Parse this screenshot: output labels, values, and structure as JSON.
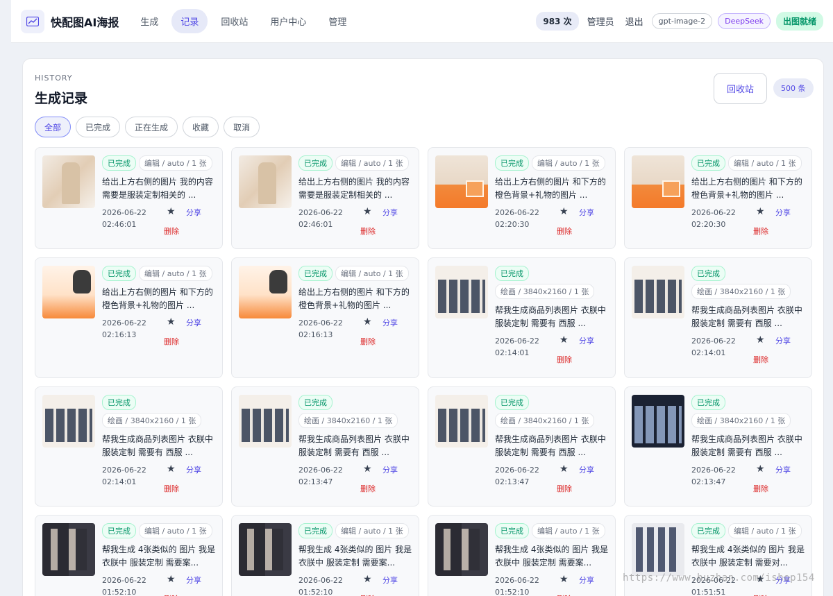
{
  "header": {
    "brand": "快配图AI海报",
    "nav": [
      "生成",
      "记录",
      "回收站",
      "用户中心",
      "管理"
    ],
    "active_nav": "记录",
    "count": "983 次",
    "role": "管理员",
    "logout": "退出",
    "model": "gpt-image-2",
    "llm": "DeepSeek",
    "status": "出图就绪"
  },
  "main": {
    "eyebrow": "HISTORY",
    "title": "生成记录",
    "recycle_label": "回收站",
    "total": "500 条",
    "filters": [
      "全部",
      "已完成",
      "正在生成",
      "收藏",
      "取消"
    ],
    "active_filter": "全部"
  },
  "card_labels": {
    "done": "已完成",
    "share": "分享",
    "delete": "删除",
    "star": "★"
  },
  "records": [
    {
      "thumb": "suit-white",
      "meta": "编辑 / auto / 1 张",
      "prompt": "给出上方右侧的图片 我的内容需要是服装定制相关的 ...",
      "date": "2026-06-22",
      "time": "02:46:01"
    },
    {
      "thumb": "suit-white",
      "meta": "编辑 / auto / 1 张",
      "prompt": "给出上方右侧的图片 我的内容需要是服装定制相关的 ...",
      "date": "2026-06-22",
      "time": "02:46:01"
    },
    {
      "thumb": "suit-orange",
      "meta": "编辑 / auto / 1 张",
      "prompt": "给出上方右侧的图片 和下方的 橙色背景+礼物的图片 ...",
      "date": "2026-06-22",
      "time": "02:20:30"
    },
    {
      "thumb": "suit-orange",
      "meta": "编辑 / auto / 1 张",
      "prompt": "给出上方右侧的图片 和下方的 橙色背景+礼物的图片 ...",
      "date": "2026-06-22",
      "time": "02:20:30"
    },
    {
      "thumb": "cat",
      "meta": "编辑 / auto / 1 张",
      "prompt": "给出上方右侧的图片 和下方的 橙色背景+礼物的图片 ...",
      "date": "2026-06-22",
      "time": "02:16:13"
    },
    {
      "thumb": "cat",
      "meta": "编辑 / auto / 1 张",
      "prompt": "给出上方右侧的图片 和下方的 橙色背景+礼物的图片 ...",
      "date": "2026-06-22",
      "time": "02:16:13"
    },
    {
      "thumb": "grid",
      "meta": "绘画 / 3840x2160 / 1 张",
      "prompt": "帮我生成商品列表图片 衣朕中 服装定制 需要有 西服 ...",
      "date": "2026-06-22",
      "time": "02:14:01"
    },
    {
      "thumb": "grid",
      "meta": "绘画 / 3840x2160 / 1 张",
      "prompt": "帮我生成商品列表图片 衣朕中 服装定制 需要有 西服 ...",
      "date": "2026-06-22",
      "time": "02:14:01"
    },
    {
      "thumb": "grid",
      "meta": "绘画 / 3840x2160 / 1 张",
      "prompt": "帮我生成商品列表图片 衣朕中 服装定制 需要有 西服 ...",
      "date": "2026-06-22",
      "time": "02:14:01"
    },
    {
      "thumb": "grid",
      "meta": "绘画 / 3840x2160 / 1 张",
      "prompt": "帮我生成商品列表图片 衣朕中 服装定制 需要有 西服 ...",
      "date": "2026-06-22",
      "time": "02:13:47"
    },
    {
      "thumb": "grid",
      "meta": "绘画 / 3840x2160 / 1 张",
      "prompt": "帮我生成商品列表图片 衣朕中 服装定制 需要有 西服 ...",
      "date": "2026-06-22",
      "time": "02:13:47"
    },
    {
      "thumb": "grid-dark",
      "meta": "绘画 / 3840x2160 / 1 张",
      "prompt": "帮我生成商品列表图片 衣朕中 服装定制 需要有 西服 ...",
      "date": "2026-06-22",
      "time": "02:13:47"
    },
    {
      "thumb": "people",
      "meta": "编辑 / auto / 1 张",
      "prompt": "帮我生成 4张类似的 图片 我是衣朕中 服装定制 需要案...",
      "date": "2026-06-22",
      "time": "01:52:10"
    },
    {
      "thumb": "people",
      "meta": "编辑 / auto / 1 张",
      "prompt": "帮我生成 4张类似的 图片 我是衣朕中 服装定制 需要案...",
      "date": "2026-06-22",
      "time": "01:52:10"
    },
    {
      "thumb": "people",
      "meta": "编辑 / auto / 1 张",
      "prompt": "帮我生成 4张类似的 图片 我是衣朕中 服装定制 需要案...",
      "date": "2026-06-22",
      "time": "01:52:10"
    },
    {
      "thumb": "people-light",
      "meta": "编辑 / auto / 1 张",
      "prompt": "帮我生成 4张类似的 图片 我是衣朕中 服装定制 需要对...",
      "date": "2026-06-22",
      "time": "01:51:51"
    }
  ],
  "watermark": "https://www.huzhan.com/ishop154"
}
